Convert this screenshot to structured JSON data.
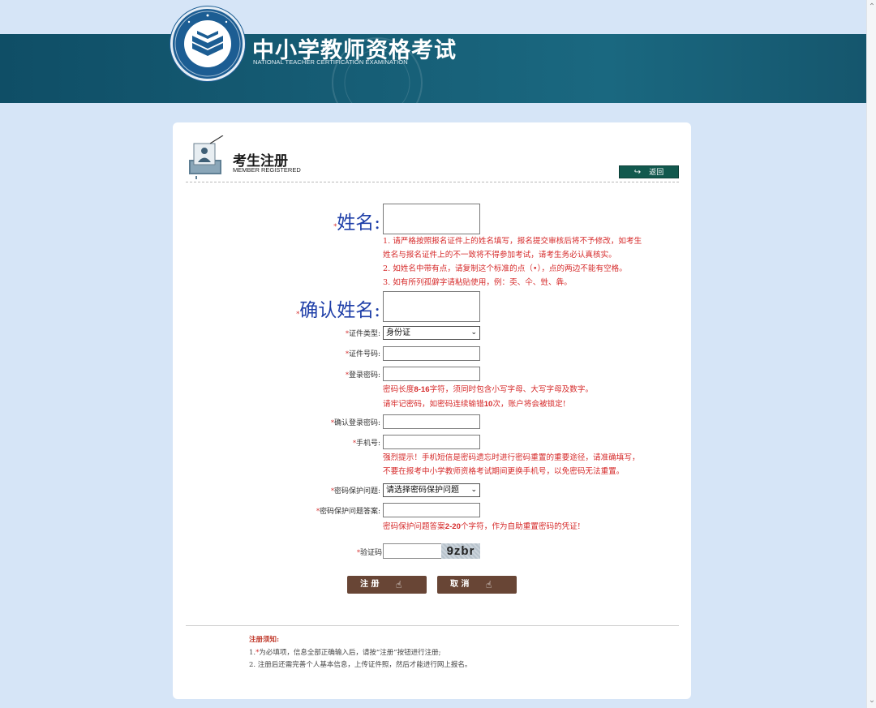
{
  "header": {
    "title": "中小学教师资格考试",
    "subtitle": "NATIONAL TEACHER CERTIFICATION EXAMINATION",
    "logo_icon": "exam-logo-icon",
    "band_color": "#165d75"
  },
  "panel": {
    "title": "考生注册",
    "subtitle": "MEMBER REGISTERED",
    "back_label": "返回",
    "icon": "registration-icon"
  },
  "form": {
    "required_mark": "*",
    "name_label": "姓名:",
    "name_hints": [
      "1. 请严格按照报名证件上的姓名填写，报名提交审核后将不予修改，如考生",
      "姓名与报名证件上的不一致将不得参加考试，请考生务必认真核实。",
      "2. 如姓名中带有点，请复制这个标准的点（•），点的两边不能有空格。",
      "3. 如有所列孤僻字请粘贴使用，例：奀、仐、甡、犇。"
    ],
    "confirm_name_label": "确认姓名:",
    "id_type_label": "证件类型:",
    "id_type_value": "身份证",
    "id_number_label": "证件号码:",
    "password_label": "登录密码:",
    "password_hint_1": {
      "pre": "密码长度",
      "num": "8-16",
      "post": "字符，须同时包含小写字母、大写字母及数字。"
    },
    "password_hint_2": {
      "pre": "请牢记密码，如密码连续输错",
      "num": "10",
      "post": "次，账户将会被锁定!"
    },
    "confirm_password_label": "确认登录密码:",
    "phone_label": "手机号:",
    "phone_hints": [
      "强烈提示！手机短信是密码遗忘时进行密码重置的重要途径，请准确填写，",
      "不要在报考中小学教师资格考试期间更换手机号，以免密码无法重置。"
    ],
    "question_label": "密码保护问题:",
    "question_value": "请选择密码保护问题",
    "answer_label": "密码保护问题答案:",
    "answer_hint": {
      "pre": "密码保护问题答案",
      "num": "2-20",
      "post": "个字符，作为自助重置密码的凭证!"
    },
    "captcha_label": "验证码",
    "captcha_text": "9zbr",
    "register_label": "注 册",
    "cancel_label": "取 消"
  },
  "notice": {
    "title": "注册须知:",
    "line1_pre": "1.",
    "line1_mark": "*",
    "line1_post": "为必填项，信息全部正确输入后，请按“注册”按钮进行注册;",
    "line2": "2. 注册后还需完善个人基本信息，上传证件照，然后才能进行网上报名。"
  },
  "colors": {
    "background": "#d6e5f7",
    "hint_red": "#d62b2b",
    "button_brown": "#684535",
    "back_green": "#12594e"
  }
}
